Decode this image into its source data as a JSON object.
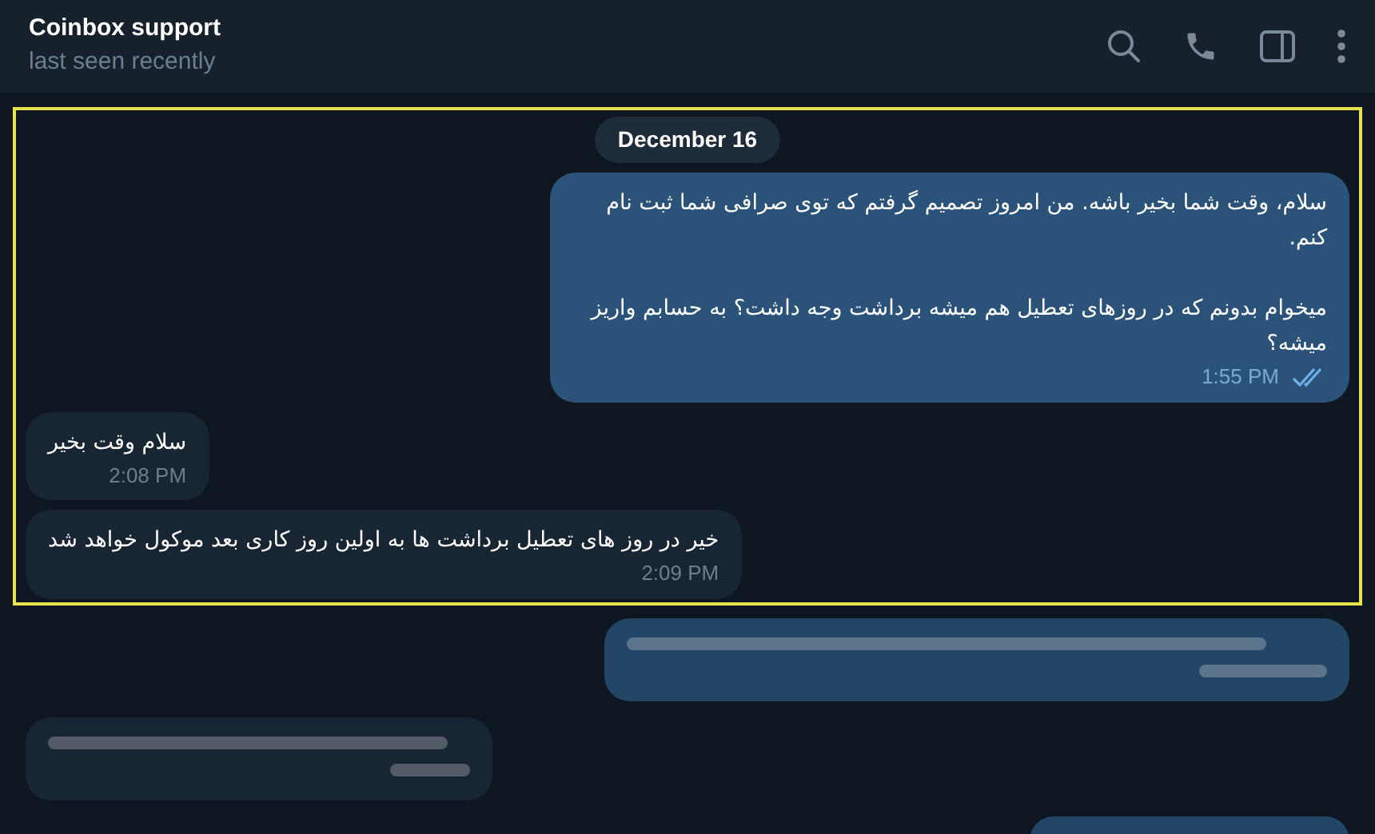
{
  "header": {
    "title": "Coinbox support",
    "status": "last seen recently"
  },
  "sections": [
    {
      "highlighted": true,
      "date": "December 16",
      "messages": [
        {
          "kind": "outgoing",
          "read": true,
          "text": "سلام، وقت شما بخیر باشه. من امروز تصمیم گرفتم که توی صرافی شما ثبت نام کنم.\n\nمیخوام بدونم که در روزهای تعطیل هم میشه برداشت وجه داشت؟ به حسابم واریز میشه؟",
          "time": "1:55 PM"
        },
        {
          "kind": "incoming",
          "text": "سلام وقت بخیر",
          "time": "2:08 PM"
        },
        {
          "kind": "incoming",
          "text": "خیر در روز های تعطیل برداشت ها به اولین روز کاری بعد موکول خواهد شد",
          "time": "2:09 PM"
        }
      ]
    },
    {
      "highlighted": false,
      "messages": [
        {
          "kind": "blurred-outgoing"
        },
        {
          "kind": "blurred-incoming"
        },
        {
          "kind": "blurred-outgoing-cut"
        }
      ]
    }
  ]
}
